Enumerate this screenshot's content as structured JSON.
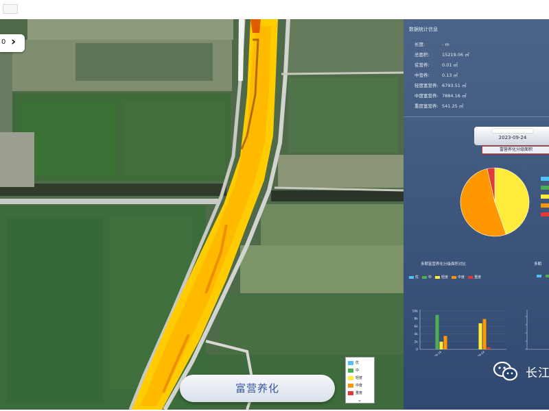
{
  "app": {
    "collapse_label": "0",
    "layer_button_label": "富营养化"
  },
  "map_legend": {
    "items": [
      {
        "label": "优",
        "color": "#4fc3f7"
      },
      {
        "label": "中",
        "color": "#4caf50"
      },
      {
        "label": "轻度",
        "color": "#ffeb3b"
      },
      {
        "label": "中度",
        "color": "#ff9800"
      },
      {
        "label": "重度",
        "color": "#e53935"
      }
    ]
  },
  "panel": {
    "title": "数据统计信息",
    "stats": [
      {
        "key": "长度:",
        "value": "- m"
      },
      {
        "key": "总面积:",
        "value": "15219.06 ㎡"
      },
      {
        "key": "贫营养:",
        "value": "0.01 ㎡"
      },
      {
        "key": "中营养:",
        "value": "0.13 ㎡"
      },
      {
        "key": "轻度富营养:",
        "value": "6793.51 ㎡"
      },
      {
        "key": "中度富营养:",
        "value": "7884.16 ㎡"
      },
      {
        "key": "重度富营养:",
        "value": "541.25 ㎡"
      }
    ],
    "date": "2023-09-24",
    "pie_title": "富营养化分级面积",
    "bar_chart_title": "多期富营养化分级面积对比",
    "bar_chart_title_right": "多期",
    "watermark_text": "长江"
  },
  "colors": {
    "excellent": "#4fc3f7",
    "medium": "#4caf50",
    "light": "#ffeb3b",
    "moderate": "#ff9800",
    "severe": "#e53935"
  },
  "chart_data": [
    {
      "type": "pie",
      "title": "富营养化分级面积",
      "categories": [
        "轻度",
        "中度",
        "重度"
      ],
      "values": [
        6793.51,
        7884.16,
        541.25
      ],
      "colors": [
        "#ffeb3b",
        "#ff9800",
        "#e53935"
      ],
      "legend_placement": "right"
    },
    {
      "type": "bar",
      "title": "多期富营养化分级面积对比",
      "categories": [
        "2023-09-16",
        "2023-09-24"
      ],
      "series": [
        {
          "name": "优",
          "values": [
            0,
            0
          ],
          "color": "#4fc3f7"
        },
        {
          "name": "中",
          "values": [
            9000,
            0
          ],
          "color": "#4caf50"
        },
        {
          "name": "轻度",
          "values": [
            2000,
            6800
          ],
          "color": "#ffeb3b"
        },
        {
          "name": "中度",
          "values": [
            3500,
            7900
          ],
          "color": "#ff9800"
        },
        {
          "name": "重度",
          "values": [
            0,
            540
          ],
          "color": "#e53935"
        }
      ],
      "yticks": [
        "0",
        "2k",
        "4k",
        "6k",
        "8k",
        "10k"
      ],
      "ylim": [
        0,
        10000
      ],
      "legend_placement": "top"
    }
  ]
}
